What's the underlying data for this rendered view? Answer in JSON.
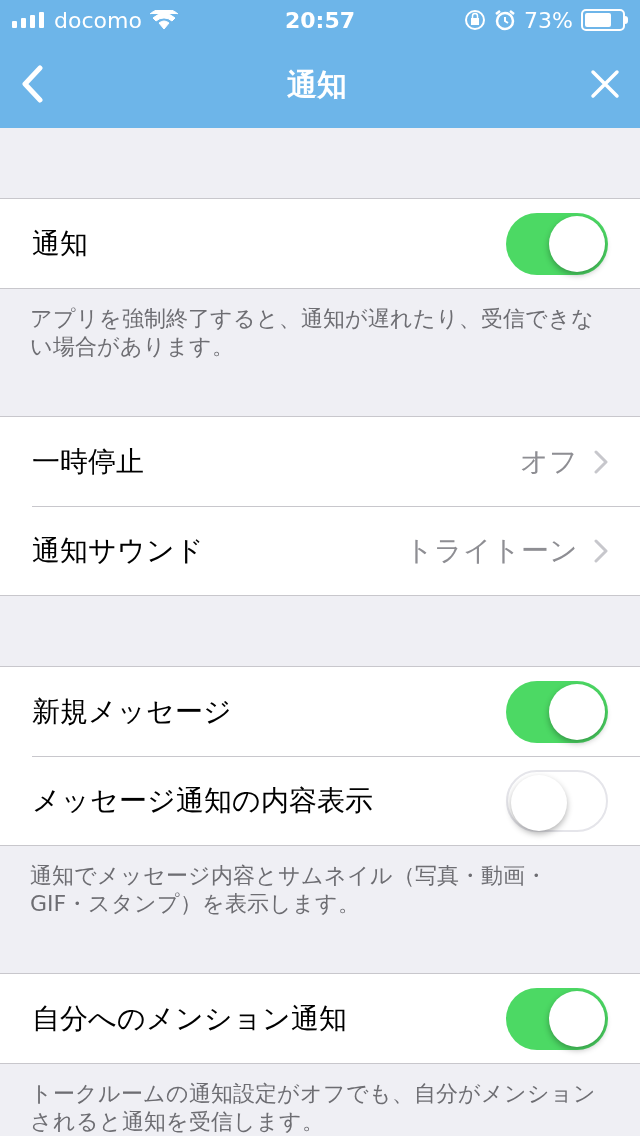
{
  "status_bar": {
    "carrier": "docomo",
    "time": "20:57",
    "battery": "73%"
  },
  "nav": {
    "title": "通知"
  },
  "sections": [
    {
      "rows": [
        {
          "kind": "toggle",
          "label": "通知",
          "on": true
        }
      ],
      "footer": "アプリを強制終了すると、通知が遅れたり、受信できない場合があります。"
    },
    {
      "rows": [
        {
          "kind": "link",
          "label": "一時停止",
          "value": "オフ"
        },
        {
          "kind": "link",
          "label": "通知サウンド",
          "value": "トライトーン"
        }
      ]
    },
    {
      "rows": [
        {
          "kind": "toggle",
          "label": "新規メッセージ",
          "on": true
        },
        {
          "kind": "toggle",
          "label": "メッセージ通知の内容表示",
          "on": false
        }
      ],
      "footer": "通知でメッセージ内容とサムネイル（写真・動画・GIF・スタンプ）を表示します。"
    },
    {
      "rows": [
        {
          "kind": "toggle",
          "label": "自分へのメンション通知",
          "on": true
        }
      ],
      "footer": "トークルームの通知設定がオフでも、自分がメンションされると通知を受信します。"
    }
  ]
}
